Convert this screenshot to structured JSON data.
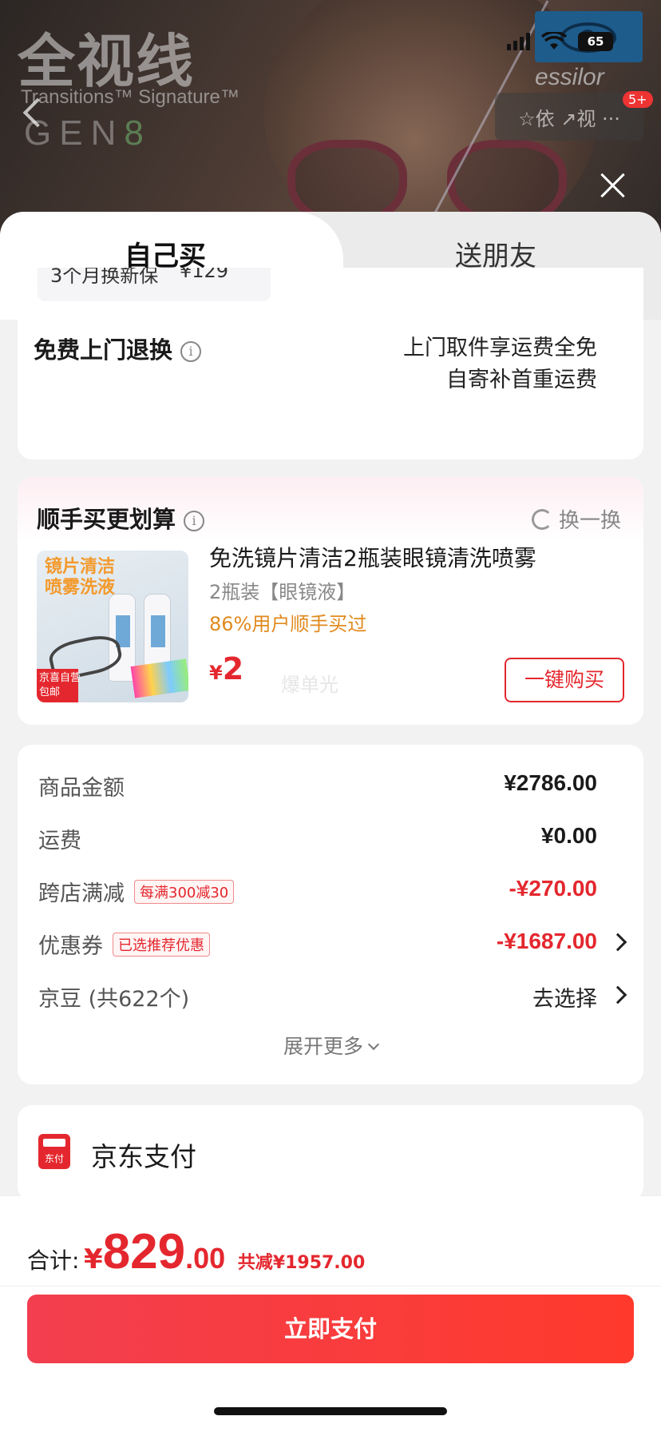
{
  "banner": {
    "brand_title": "全视线",
    "brand_sub": "Transitions™ Signature™",
    "brand_gen": "GEN",
    "brand_gen_num": "8",
    "logo_text": "essilor"
  },
  "status": {
    "battery": "65"
  },
  "nav": {
    "badge": "5+",
    "actions_text": "☆依 ↗视 ···"
  },
  "tabs": {
    "mine": "自己买",
    "friend": "送朋友"
  },
  "service": {
    "partial_name": "3个月换新保",
    "partial_price": "¥129",
    "title": "免费上门退换",
    "info_icon": "i",
    "desc_line1": "上门取件享运费全免",
    "desc_line2": "自寄补首重运费"
  },
  "addon": {
    "title": "顺手买更划算",
    "swap_label": "换一换",
    "image_text": "镜片清洁\n喷雾洗液",
    "image_tag": "京喜自营\n包邮",
    "product_name": "免洗镜片清洁2瓶装眼镜清洗喷雾",
    "spec": "2瓶装【眼镜液】",
    "hint": "86%用户顺手买过",
    "price_symbol": "¥",
    "price": "2",
    "watermark": "爆单光",
    "buy_label": "一键购买"
  },
  "fees": {
    "goods_label": "商品金额",
    "goods_value": "¥2786.00",
    "shipping_label": "运费",
    "shipping_value": "¥0.00",
    "cross_label": "跨店满减",
    "cross_tag": "每满300减30",
    "cross_value": "-¥270.00",
    "coupon_label": "优惠券",
    "coupon_tag": "已选推荐优惠",
    "coupon_value": "-¥1687.00",
    "beans_label": "京豆 (共622个)",
    "beans_value": "去选择",
    "expand_label": "展开更多"
  },
  "payment": {
    "icon_text": "东付",
    "name": "京东支付"
  },
  "footer": {
    "total_label": "合计:",
    "total_symbol": "¥",
    "total_int": "829",
    "total_dec": ".00",
    "saved": "共减¥1957.00",
    "pay_label": "立即支付"
  },
  "colors": {
    "accent": "#e4272e",
    "hint": "#e08a1e",
    "button_start": "#f23e4f",
    "button_end": "#ff3a2c"
  }
}
